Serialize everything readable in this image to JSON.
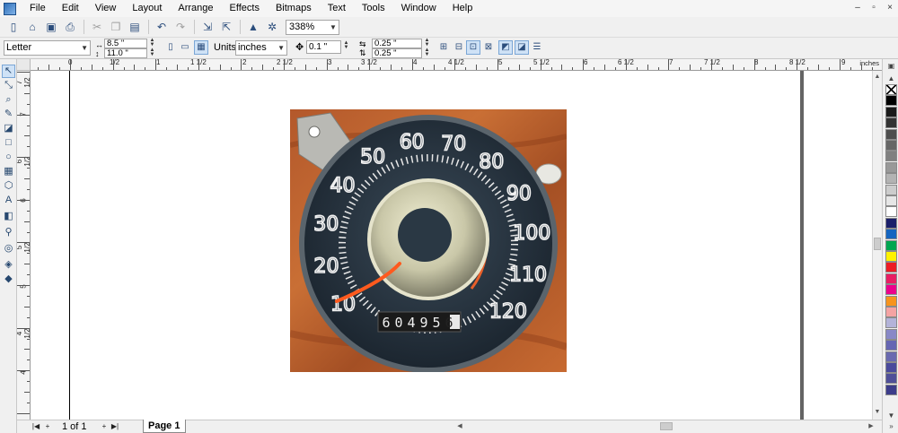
{
  "menu": {
    "items": [
      "File",
      "Edit",
      "View",
      "Layout",
      "Arrange",
      "Effects",
      "Bitmaps",
      "Text",
      "Tools",
      "Window",
      "Help"
    ]
  },
  "window_controls": {
    "minimize": "–",
    "restore": "▫",
    "close": "×"
  },
  "toolbar": {
    "zoom_value": "338%"
  },
  "property_bar": {
    "page_size": "Letter",
    "page_width": "8.5 \"",
    "page_height": "11.0 \"",
    "units_label": "Units:",
    "units_value": "inches",
    "nudge_value": "0.1 \"",
    "duplicate_x": "0.25 \"",
    "duplicate_y": "0.25 \""
  },
  "rulers": {
    "unit_label": "inches",
    "h_labels": [
      "1/2",
      "1",
      "1 1/2",
      "2",
      "2 1/2",
      "3",
      "3 1/2",
      "4",
      "4 1/2",
      "5",
      "5 1/2",
      "6",
      "6 1/2",
      "7",
      "7 1/2",
      "8",
      "8 1/2",
      "9"
    ],
    "h_zero": "0",
    "v_labels": [
      "7 1/2",
      "7",
      "6 1/2",
      "6",
      "5 1/2",
      "5",
      "4 1/2",
      "4"
    ]
  },
  "image": {
    "odometer_digits": [
      "6",
      "0",
      "4",
      "9",
      "5",
      "6"
    ],
    "speed_marks": [
      "10",
      "20",
      "30",
      "40",
      "50",
      "60",
      "70",
      "80",
      "90",
      "100",
      "110",
      "120"
    ]
  },
  "colors": {
    "page_shadow": "#646464",
    "tool_active_bg": "#cfe2f6",
    "palette": [
      "#ffffff",
      "#000000",
      "#1a1a1a",
      "#333333",
      "#4d4d4d",
      "#666666",
      "#808080",
      "#999999",
      "#b3b3b3",
      "#cccccc",
      "#e6e6e6",
      "#ffffff",
      "#1b1f6a",
      "#1565c0",
      "#00a651",
      "#fff200",
      "#ed1c24",
      "#e91e63",
      "#ec008c",
      "#f7941d",
      "#f5a3a3",
      "#b3b3d9",
      "#8888c7",
      "#6666b3",
      "#6a6ab0",
      "#4a4a9c",
      "#4f4f98",
      "#3c3c8a"
    ]
  },
  "status": {
    "page_count": "1 of 1",
    "page_tab": "Page 1"
  }
}
